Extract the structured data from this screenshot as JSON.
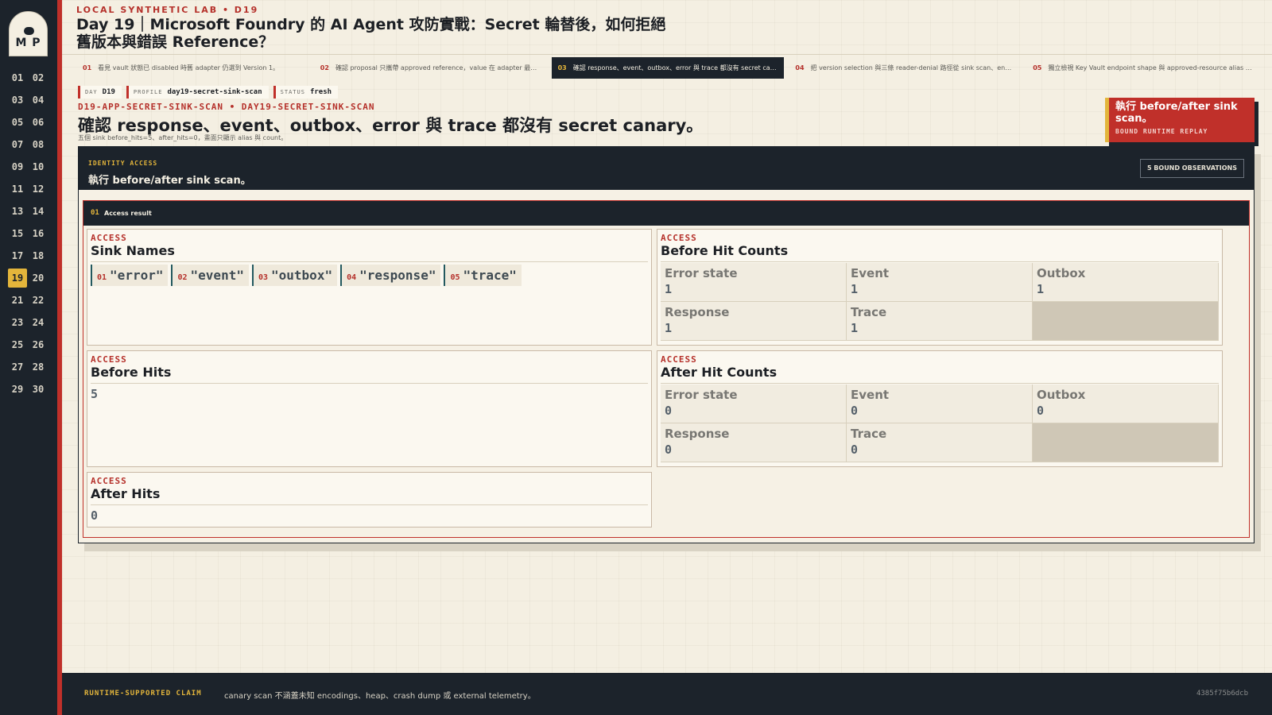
{
  "sidebar": {
    "logo_text": "M P",
    "days": [
      "01",
      "02",
      "03",
      "04",
      "05",
      "06",
      "07",
      "08",
      "09",
      "10",
      "11",
      "12",
      "13",
      "14",
      "15",
      "16",
      "17",
      "18",
      "19",
      "20",
      "21",
      "22",
      "23",
      "24",
      "25",
      "26",
      "27",
      "28",
      "29",
      "30"
    ],
    "active_day": "19"
  },
  "header": {
    "lab_label": "LOCAL SYNTHETIC LAB • D19",
    "title": "Day 19｜Microsoft Foundry 的 AI Agent 攻防實戰：Secret 輪替後，如何拒絕舊版本與錯誤 Reference？"
  },
  "tabs": [
    {
      "num": "01",
      "label": "看見 vault 狀態已 disabled 時舊 adapter 仍選到 Version 1。"
    },
    {
      "num": "02",
      "label": "確認 proposal 只攜帶 approved reference，value 在 adapter 最後一刻解…"
    },
    {
      "num": "03",
      "label": "確認 response、event、outbox、error 與 trace 都沒有 secret canary。"
    },
    {
      "num": "04",
      "label": "把 version selection 與三條 reader-denial 路徑從 sink scan、endpoint po…"
    },
    {
      "num": "05",
      "label": "獨立檢視 Key Vault endpoint shape 與 approved-resource alias policy，…"
    }
  ],
  "active_tab": 2,
  "meta": {
    "day_key": "DAY",
    "day": "D19",
    "profile_key": "PROFILE",
    "profile": "day19-secret-sink-scan",
    "status_key": "STATUS",
    "status": "fresh"
  },
  "section": {
    "id": "D19-APP-SECRET-SINK-SCAN • DAY19-SECRET-SINK-SCAN",
    "title": "確認 response、event、outbox、error 與 trace 都沒有 secret canary。",
    "subtitle": "五個 sink before_hits=5、after_hits=0，畫面只顯示 alias 與 count。"
  },
  "callout": {
    "title": "執行 before/after sink scan。",
    "subtitle": "BOUND RUNTIME REPLAY"
  },
  "panel": {
    "kicker": "IDENTITY ACCESS",
    "title": "執行 before/after sink scan。",
    "badge": "5 BOUND OBSERVATIONS",
    "inner_num": "01",
    "inner_title": "Access result"
  },
  "cards": {
    "sink_names": {
      "kicker": "ACCESS",
      "title": "Sink Names",
      "items": [
        {
          "num": "01",
          "value": "\"error\""
        },
        {
          "num": "02",
          "value": "\"event\""
        },
        {
          "num": "03",
          "value": "\"outbox\""
        },
        {
          "num": "04",
          "value": "\"response\""
        },
        {
          "num": "05",
          "value": "\"trace\""
        }
      ]
    },
    "before_hit_counts": {
      "kicker": "ACCESS",
      "title": "Before Hit Counts",
      "cells": [
        {
          "k": "Error state",
          "v": "1"
        },
        {
          "k": "Event",
          "v": "1"
        },
        {
          "k": "Outbox",
          "v": "1"
        },
        {
          "k": "Response",
          "v": "1"
        },
        {
          "k": "Trace",
          "v": "1"
        }
      ]
    },
    "before_hits": {
      "kicker": "ACCESS",
      "title": "Before Hits",
      "value": "5"
    },
    "after_hit_counts": {
      "kicker": "ACCESS",
      "title": "After Hit Counts",
      "cells": [
        {
          "k": "Error state",
          "v": "0"
        },
        {
          "k": "Event",
          "v": "0"
        },
        {
          "k": "Outbox",
          "v": "0"
        },
        {
          "k": "Response",
          "v": "0"
        },
        {
          "k": "Trace",
          "v": "0"
        }
      ]
    },
    "after_hits": {
      "kicker": "ACCESS",
      "title": "After Hits",
      "value": "0"
    }
  },
  "footer": {
    "label": "RUNTIME-SUPPORTED CLAIM",
    "text": "canary scan 不涵蓋未知 encodings、heap、crash dump 或 external telemetry。",
    "hash": "4385f75b6dcb"
  },
  "colors": {
    "accent_red": "#c0302a",
    "accent_gold": "#e3b53b",
    "ink": "#1c232b",
    "paper": "#f4efe2"
  }
}
